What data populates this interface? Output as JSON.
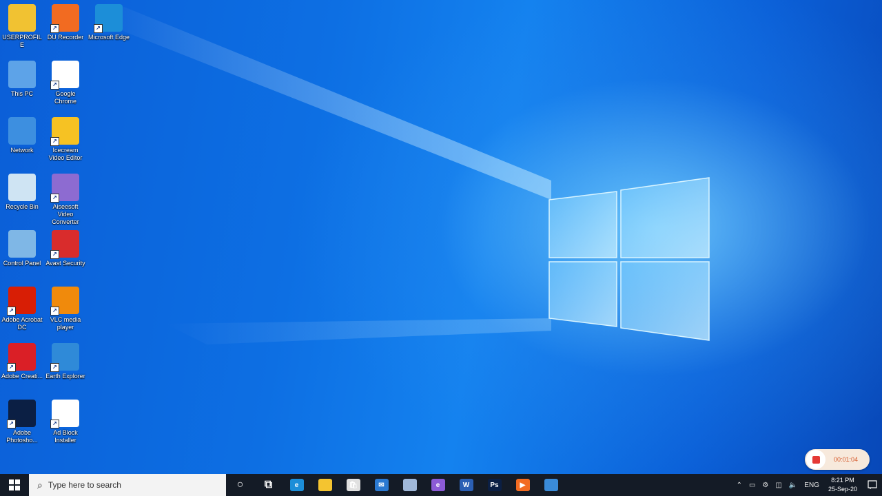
{
  "desktop_icons": [
    {
      "label": "USERPROFILE",
      "icon": "user-folder-icon",
      "color": "#f1c232"
    },
    {
      "label": "This PC",
      "icon": "this-pc-icon",
      "color": "#5da3e8"
    },
    {
      "label": "Network",
      "icon": "network-icon",
      "color": "#3d8fe0"
    },
    {
      "label": "Recycle Bin",
      "icon": "recycle-bin-icon",
      "color": "#cfe4f3"
    },
    {
      "label": "Control Panel",
      "icon": "control-panel-icon",
      "color": "#7fb7e6"
    },
    {
      "label": "Adobe Acrobat DC",
      "icon": "acrobat-icon",
      "color": "#d81e05"
    },
    {
      "label": "Adobe Creati...",
      "icon": "creative-cloud-icon",
      "color": "#da1f26"
    },
    {
      "label": "Adobe Photosho...",
      "icon": "photoshop-icon",
      "color": "#0b1f44"
    },
    {
      "label": "DU Recorder",
      "icon": "du-recorder-icon",
      "color": "#f26b21"
    },
    {
      "label": "Google Chrome",
      "icon": "chrome-icon",
      "color": "#ffffff"
    },
    {
      "label": "Icecream Video Editor",
      "icon": "video-editor-icon",
      "color": "#f6c223"
    },
    {
      "label": "Aiseesoft Video Converter",
      "icon": "video-converter-icon",
      "color": "#8d6bd1"
    },
    {
      "label": "Avast Security",
      "icon": "shield-icon",
      "color": "#d92c2c"
    },
    {
      "label": "VLC media player",
      "icon": "vlc-icon",
      "color": "#f08a0c"
    },
    {
      "label": "Earth Explorer",
      "icon": "globe-icon",
      "color": "#2f8ad8"
    },
    {
      "label": "Ad Block Installer",
      "icon": "chrome-icon",
      "color": "#ffffff"
    },
    {
      "label": "Microsoft Edge",
      "icon": "edge-icon",
      "color": "#1c8ed8"
    }
  ],
  "taskbar": {
    "search_placeholder": "Type here to search",
    "apps": [
      {
        "icon": "cortana-icon",
        "color": "#ffffff",
        "glyph": "○"
      },
      {
        "icon": "task-view-icon",
        "color": "#ffffff",
        "glyph": "⧉"
      },
      {
        "icon": "edge-icon",
        "color": "#1c8ed8",
        "glyph": "e"
      },
      {
        "icon": "file-explorer-icon",
        "color": "#f4c430",
        "glyph": ""
      },
      {
        "icon": "store-icon",
        "color": "#e0e0e0",
        "glyph": "🛍"
      },
      {
        "icon": "mail-icon",
        "color": "#2b79d1",
        "glyph": "✉"
      },
      {
        "icon": "app-icon",
        "color": "#9fb7d8",
        "glyph": ""
      },
      {
        "icon": "browser-icon",
        "color": "#8c5bd6",
        "glyph": "e"
      },
      {
        "icon": "word-icon",
        "color": "#2b5fb4",
        "glyph": "W"
      },
      {
        "icon": "photoshop-icon",
        "color": "#0b1f44",
        "glyph": "Ps"
      },
      {
        "icon": "du-recorder-icon",
        "color": "#f26b21",
        "glyph": "▶"
      },
      {
        "icon": "photos-icon",
        "color": "#3a8bd8",
        "glyph": ""
      }
    ],
    "tray": {
      "language": "ENG",
      "time": "8:21 PM",
      "date": "25-Sep-20"
    }
  },
  "recording": {
    "elapsed": "00:01:04",
    "accent": "#e53935"
  }
}
